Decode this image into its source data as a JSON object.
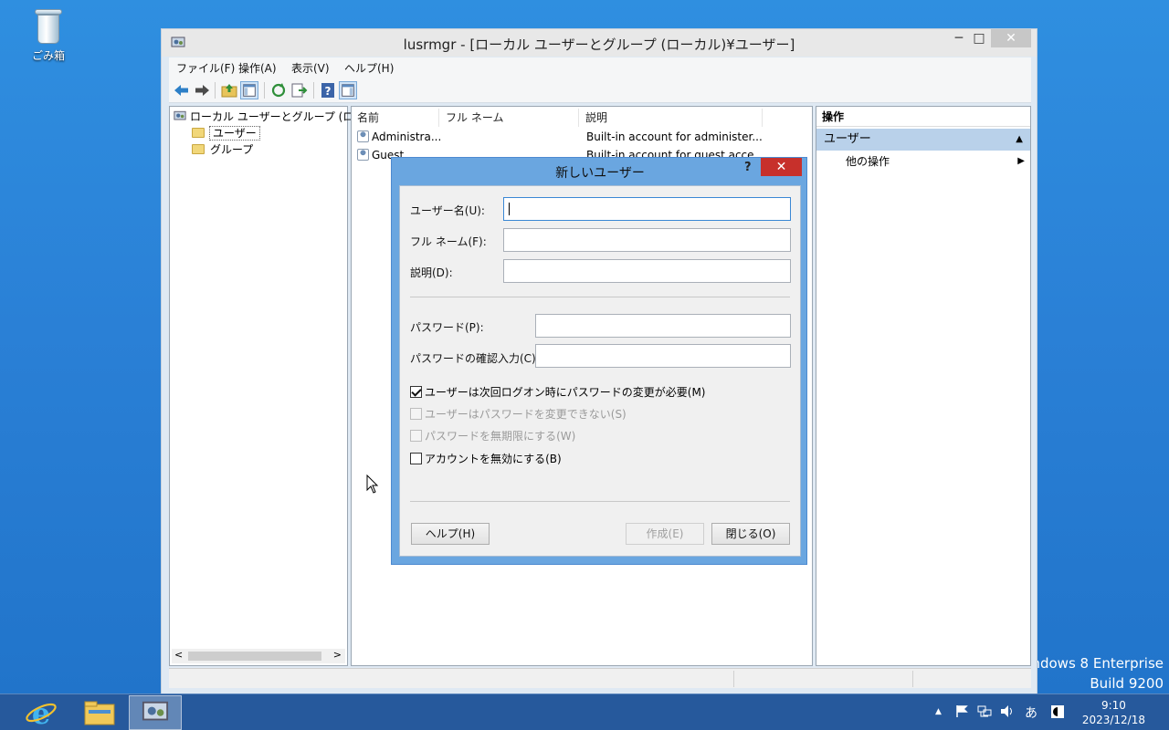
{
  "desktop": {
    "recycle_bin_label": "ごみ箱",
    "watermark_line1": "ndows 8 Enterprise",
    "watermark_line2": "Build 9200"
  },
  "window": {
    "title": "lusrmgr - [ローカル ユーザーとグループ (ローカル)¥ユーザー]",
    "minimize_glyph": "─",
    "maximize_glyph": "□",
    "close_glyph": "✕"
  },
  "menu": {
    "items": [
      "ファイル(F)",
      "操作(A)",
      "表示(V)",
      "ヘルプ(H)"
    ]
  },
  "tree": {
    "root": "ローカル ユーザーとグループ (ローカル",
    "items": [
      "ユーザー",
      "グループ"
    ],
    "scroll_left": "<",
    "scroll_right": ">"
  },
  "list": {
    "columns": [
      "名前",
      "フル ネーム",
      "説明"
    ],
    "rows": [
      {
        "name": "Administra...",
        "full_name": "",
        "description": "Built-in account for administer..."
      },
      {
        "name": "Guest",
        "full_name": "",
        "description": "Built-in account for guest acce..."
      }
    ]
  },
  "actions": {
    "header": "操作",
    "section": "ユーザー",
    "section_glyph": "▲",
    "item": "他の操作",
    "item_glyph": "▶"
  },
  "dialog": {
    "title": "新しいユーザー",
    "help_glyph": "?",
    "close_glyph": "✕",
    "fields": {
      "username_label": "ユーザー名(U):",
      "username_value": "",
      "fullname_label": "フル ネーム(F):",
      "fullname_value": "",
      "description_label": "説明(D):",
      "description_value": "",
      "password_label": "パスワード(P):",
      "password_value": "",
      "confirm_label": "パスワードの確認入力(C):",
      "confirm_value": ""
    },
    "checkboxes": [
      {
        "label": "ユーザーは次回ログオン時にパスワードの変更が必要(M)",
        "checked": true,
        "enabled": true
      },
      {
        "label": "ユーザーはパスワードを変更できない(S)",
        "checked": false,
        "enabled": false
      },
      {
        "label": "パスワードを無期限にする(W)",
        "checked": false,
        "enabled": false
      },
      {
        "label": "アカウントを無効にする(B)",
        "checked": false,
        "enabled": true
      }
    ],
    "buttons": {
      "help": "ヘルプ(H)",
      "create": "作成(E)",
      "close": "閉じる(O)"
    }
  },
  "taskbar": {
    "tray_expand": "▲",
    "ime": "あ",
    "time": "9:10",
    "date": "2023/12/18"
  },
  "colors": {
    "dialog_frame": "#6aa6e0",
    "close_red": "#c7302b",
    "selection_blue": "#b9d1ea"
  }
}
